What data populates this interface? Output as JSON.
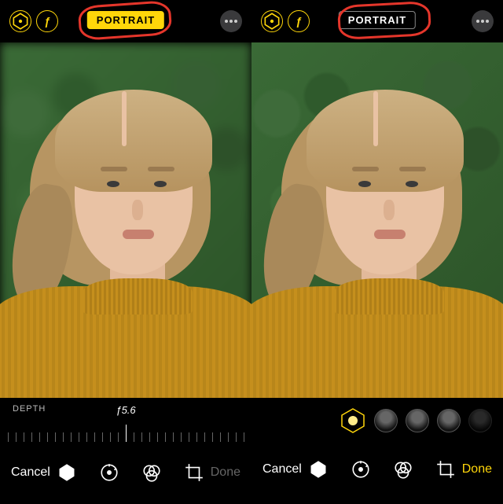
{
  "left": {
    "topbar": {
      "portrait_label": "PORTRAIT",
      "portrait_active": true
    },
    "depth": {
      "label": "DEPTH",
      "value": "ƒ5.6"
    },
    "bottom": {
      "cancel": "Cancel",
      "done": "Done",
      "done_active": false
    }
  },
  "right": {
    "topbar": {
      "portrait_label": "PORTRAIT",
      "portrait_active": false
    },
    "bottom": {
      "cancel": "Cancel",
      "done": "Done",
      "done_active": true
    }
  },
  "colors": {
    "accent": "#ffd60a",
    "annot": "#e5362b"
  }
}
